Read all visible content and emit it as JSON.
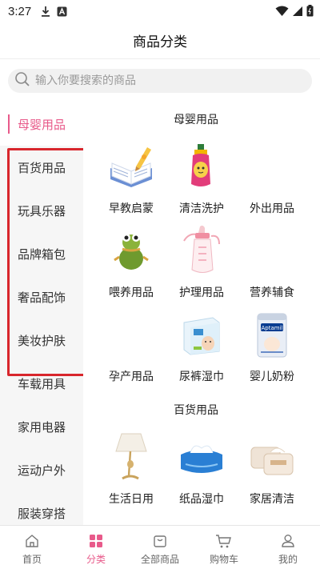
{
  "status_bar": {
    "time": "3:27"
  },
  "header": {
    "title": "商品分类"
  },
  "search": {
    "placeholder": "输入你要搜索的商品"
  },
  "sidebar": {
    "items": [
      {
        "label": "母婴用品",
        "active": true
      },
      {
        "label": "百货用品"
      },
      {
        "label": "玩具乐器"
      },
      {
        "label": "品牌箱包"
      },
      {
        "label": "奢品配饰"
      },
      {
        "label": "美妆护肤"
      },
      {
        "label": "车载用具"
      },
      {
        "label": "家用电器"
      },
      {
        "label": "运动户外"
      },
      {
        "label": "服装穿搭"
      }
    ]
  },
  "content": {
    "sections": [
      {
        "title": "母婴用品",
        "items": [
          {
            "label": "早教启蒙",
            "icon": "book-icon"
          },
          {
            "label": "清洁洗护",
            "icon": "bottle-icon"
          },
          {
            "label": "外出用品",
            "icon": ""
          },
          {
            "label": "喂养用品",
            "icon": "sippy-cup-icon"
          },
          {
            "label": "护理用品",
            "icon": "baby-bottle-icon"
          },
          {
            "label": "营养辅食",
            "icon": ""
          },
          {
            "label": "孕产用品",
            "icon": ""
          },
          {
            "label": "尿裤湿巾",
            "icon": "diaper-pack-icon"
          },
          {
            "label": "婴儿奶粉",
            "icon": "milk-powder-icon"
          }
        ]
      },
      {
        "title": "百货用品",
        "items": [
          {
            "label": "生活日用",
            "icon": "lamp-icon"
          },
          {
            "label": "纸品湿巾",
            "icon": "tissue-pack-icon"
          },
          {
            "label": "家居清洁",
            "icon": "wipes-icon"
          }
        ]
      }
    ],
    "milk_brand": "Aptamil"
  },
  "tabbar": {
    "tabs": [
      {
        "label": "首页",
        "icon": "home-icon"
      },
      {
        "label": "分类",
        "icon": "category-icon",
        "active": true
      },
      {
        "label": "全部商品",
        "icon": "bag-icon"
      },
      {
        "label": "购物车",
        "icon": "cart-icon"
      },
      {
        "label": "我的",
        "icon": "user-icon"
      }
    ]
  },
  "colors": {
    "accent": "#e85a8a",
    "highlight_border": "#d8262c",
    "sidebar_bg": "#f6f6f6"
  }
}
